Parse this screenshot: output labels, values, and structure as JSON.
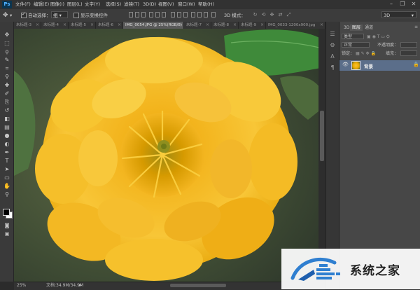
{
  "app": {
    "logo": "Ps"
  },
  "menu": [
    "文件(F)",
    "编辑(E)",
    "图像(I)",
    "图层(L)",
    "文字(Y)",
    "选择(S)",
    "滤镜(T)",
    "3D(D)",
    "视图(V)",
    "窗口(W)",
    "帮助(H)"
  ],
  "window_controls": {
    "minimize": "–",
    "restore": "❐",
    "close": "✕"
  },
  "options": {
    "auto_select_label": "自动选择：",
    "auto_select_value": "组",
    "show_transform_label": "显示变换控件",
    "mode_3d_label": "3D 模式：",
    "workspace_value": "3D"
  },
  "tabs": [
    {
      "label": "未标题-3",
      "active": false
    },
    {
      "label": "未标题-4",
      "active": false
    },
    {
      "label": "未标题-5",
      "active": false
    },
    {
      "label": "未标题-6",
      "active": false
    },
    {
      "label": "IMG_0054.JPG @ 25%(RGB/8)",
      "active": true
    },
    {
      "label": "未标题-7",
      "active": false
    },
    {
      "label": "未标题-8",
      "active": false
    },
    {
      "label": "未标题-9",
      "active": false
    },
    {
      "label": "IMG_0033-1200x900.jpg",
      "active": false
    }
  ],
  "tools": [
    "move-icon",
    "marquee-icon",
    "lasso-icon",
    "quick-select-icon",
    "crop-icon",
    "eyedropper-icon",
    "healing-icon",
    "brush-icon",
    "clone-stamp-icon",
    "history-brush-icon",
    "eraser-icon",
    "gradient-icon",
    "blur-icon",
    "dodge-icon",
    "pen-icon",
    "type-icon",
    "path-select-icon",
    "shape-icon",
    "hand-icon",
    "zoom-icon"
  ],
  "tool_glyphs": [
    "✥",
    "⬚",
    "ϙ",
    "✎",
    "⌗",
    "⚲",
    "✚",
    "✐",
    "⎘",
    "↺",
    "◧",
    "▤",
    "●",
    "◐",
    "✒",
    "T",
    "➤",
    "▭",
    "✋",
    "⚲"
  ],
  "colors": {
    "foreground": "#000000",
    "background": "#ffffff",
    "accent_selected_layer": "#5b6e8a"
  },
  "panels": {
    "tabs": [
      "3D",
      "图层",
      "通道"
    ],
    "active_tab": "图层",
    "kind_label": "类型",
    "blend_mode": "正常",
    "opacity_label": "不透明度：",
    "lock_label": "锁定：",
    "fill_label": "填充：",
    "layers": [
      {
        "name": "背景",
        "locked": true,
        "visible": true,
        "selected": true
      }
    ]
  },
  "status": {
    "zoom": "25%",
    "doc_info": "文档:34.9M/34.9M"
  },
  "watermark": {
    "text": "系统之家"
  }
}
